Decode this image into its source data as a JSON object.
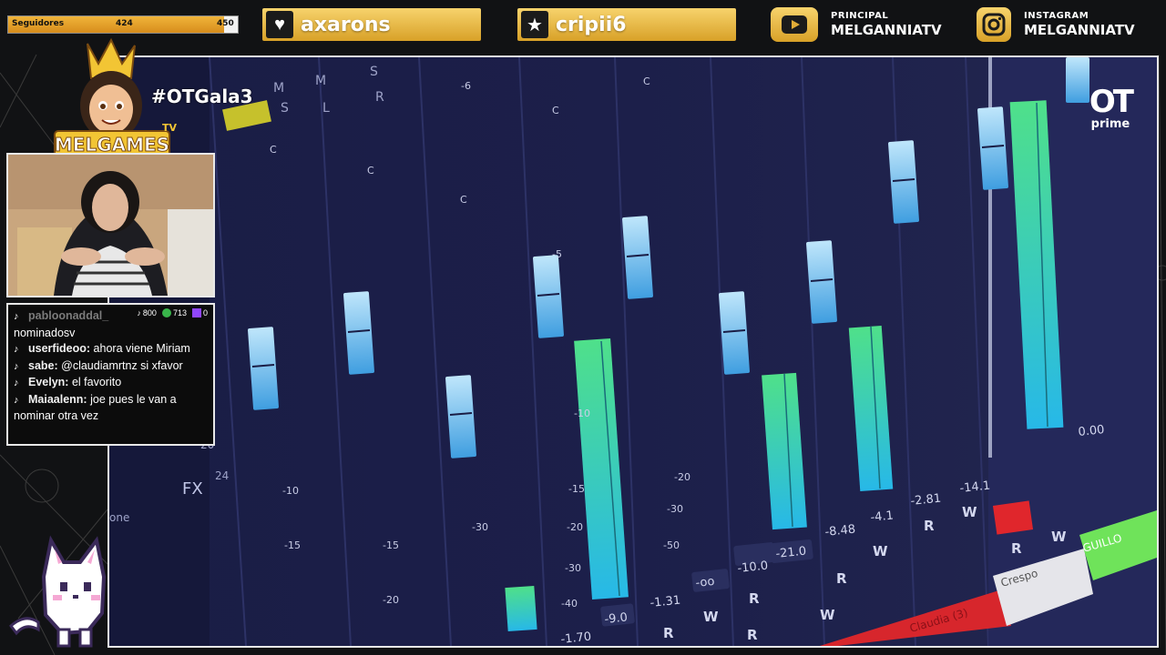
{
  "followers": {
    "label": "Seguidores",
    "current": "424",
    "goal": "450",
    "progress": 0.94
  },
  "tags": [
    {
      "icon": "heart-icon",
      "name": "axarons"
    },
    {
      "icon": "star-icon",
      "name": "cripii6"
    }
  ],
  "socials": [
    {
      "icon": "youtube-icon",
      "label": "PRINCIPAL",
      "handle": "MELGANNIATV"
    },
    {
      "icon": "instagram-icon",
      "label": "INSTAGRAM",
      "handle": "MELGANNIATV"
    }
  ],
  "brand": {
    "logo_text": "MELGAMES",
    "logo_tv": "TV",
    "hashtag": "#OTGala3"
  },
  "stream_logo": {
    "top": "OT",
    "bottom": "prime"
  },
  "chat": {
    "stats": {
      "tiktok": "800",
      "xbox": "713",
      "twitch": "0"
    },
    "messages": [
      {
        "user": "pabloonaddal_",
        "text": "nominadosv",
        "faded": true
      },
      {
        "user": "userfideoo:",
        "text": "ahora viene Miriam",
        "faded": false
      },
      {
        "user": "sabe:",
        "text": "@claudiamrtnz si xfavor",
        "faded": false
      },
      {
        "user": "Evelyn:",
        "text": "el favorito",
        "faded": false
      },
      {
        "user": "Maiaalenn:",
        "text": "joe pues le van a nominar otra vez",
        "faded": false
      }
    ]
  },
  "mixer_labels": {
    "channels": [
      "Claudia (3)",
      "Crespo",
      "GUILLO"
    ],
    "readings": [
      "-9.0",
      "-1.31",
      "-oo",
      "-10.0",
      "-21.0",
      "-8.48",
      "-4.1",
      "-2.81",
      "-14.1",
      "-1.70",
      "0.00"
    ],
    "buttons": [
      "M",
      "S",
      "L",
      "R",
      "W",
      "FX"
    ]
  },
  "colors": {
    "gold": "#e2ad37",
    "meter_green": "#43d98f",
    "meter_cyan": "#2fc3e6",
    "fader_blue": "#7fc8f2",
    "mixer_bg": "#161a3a"
  }
}
